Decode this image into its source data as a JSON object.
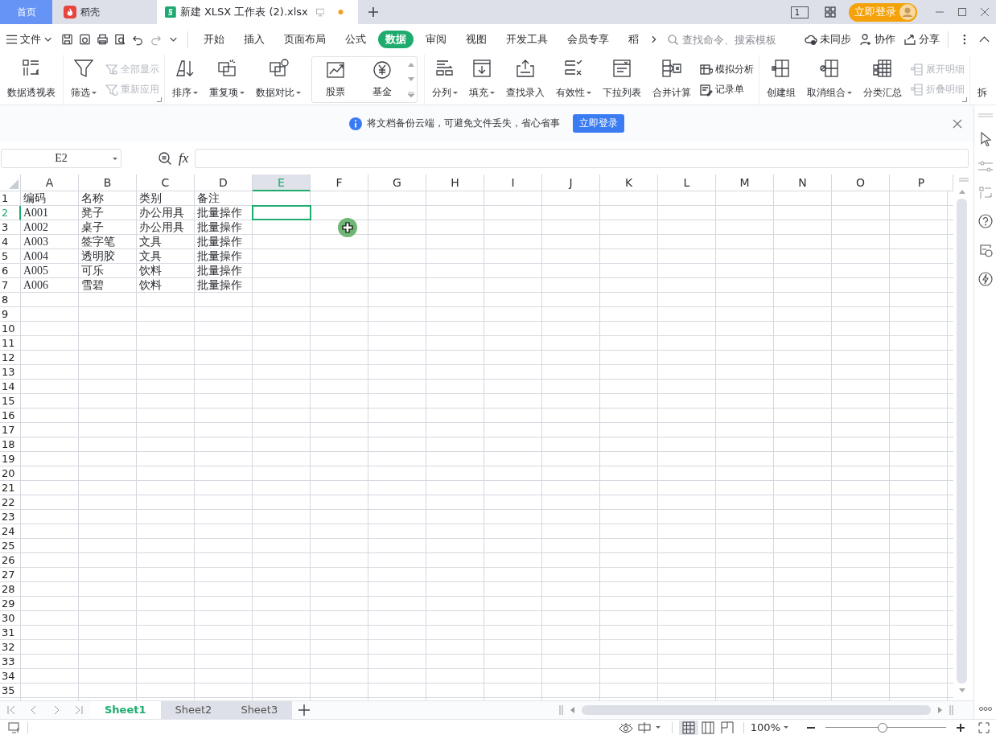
{
  "title_bar": {
    "tabs": [
      {
        "kind": "home",
        "label": "首页",
        "selected": false
      },
      {
        "kind": "docer",
        "label": "稻壳",
        "selected": false
      },
      {
        "kind": "sheet",
        "label": "新建 XLSX 工作表 (2).xlsx",
        "selected": true,
        "unsaved": true
      }
    ],
    "page_count": "1",
    "login_button": "立即登录"
  },
  "menu_bar": {
    "file_menu": "文件",
    "tabs": [
      {
        "label": "开始",
        "selected": false
      },
      {
        "label": "插入",
        "selected": false
      },
      {
        "label": "页面布局",
        "selected": false
      },
      {
        "label": "公式",
        "selected": false
      },
      {
        "label": "数据",
        "selected": true
      },
      {
        "label": "审阅",
        "selected": false
      },
      {
        "label": "视图",
        "selected": false
      },
      {
        "label": "开发工具",
        "selected": false
      },
      {
        "label": "会员专享",
        "selected": false
      },
      {
        "label": "稻",
        "selected": false
      }
    ],
    "search": {
      "placeholder": "查找命令、搜索模板"
    },
    "actions": [
      {
        "label": "未同步"
      },
      {
        "label": "协作"
      },
      {
        "label": "分享"
      }
    ]
  },
  "ribbon": {
    "groups": [
      {
        "launcher": false,
        "items": [
          {
            "kind": "large",
            "label": "数据透视表",
            "dropdown": false
          }
        ]
      },
      {
        "launcher": true,
        "items": [
          {
            "kind": "large",
            "label": "筛选",
            "dropdown": true
          },
          {
            "kind": "stack",
            "items": [
              {
                "label": "全部显示",
                "disabled": true
              },
              {
                "label": "重新应用",
                "disabled": true
              }
            ]
          }
        ]
      },
      {
        "launcher": false,
        "items": [
          {
            "kind": "large",
            "label": "排序",
            "dropdown": true
          },
          {
            "kind": "large",
            "label": "重复项",
            "dropdown": true
          },
          {
            "kind": "large",
            "label": "数据对比",
            "dropdown": true
          },
          {
            "kind": "gallery",
            "items": [
              {
                "label": "股票"
              },
              {
                "label": "基金"
              }
            ]
          }
        ]
      },
      {
        "launcher": false,
        "items": [
          {
            "kind": "large",
            "label": "分列",
            "dropdown": true
          },
          {
            "kind": "large",
            "label": "填充",
            "dropdown": true
          },
          {
            "kind": "large",
            "label": "查找录入",
            "dropdown": false
          },
          {
            "kind": "large",
            "label": "有效性",
            "dropdown": true
          },
          {
            "kind": "large",
            "label": "下拉列表",
            "dropdown": false
          },
          {
            "kind": "large",
            "label": "合并计算",
            "dropdown": false
          },
          {
            "kind": "stack",
            "items": [
              {
                "label": "模拟分析",
                "disabled": false
              },
              {
                "label": "记录单",
                "disabled": false
              }
            ]
          }
        ]
      },
      {
        "launcher": true,
        "items": [
          {
            "kind": "large",
            "label": "创建组",
            "dropdown": false
          },
          {
            "kind": "large",
            "label": "取消组合",
            "dropdown": true
          },
          {
            "kind": "large",
            "label": "分类汇总",
            "dropdown": false
          },
          {
            "kind": "stack",
            "items": [
              {
                "label": "展开明细",
                "disabled": true
              },
              {
                "label": "折叠明细",
                "disabled": true
              }
            ]
          }
        ]
      },
      {
        "launcher": false,
        "items": [
          {
            "kind": "large",
            "label": "拆",
            "dropdown": false
          }
        ]
      }
    ]
  },
  "notice": {
    "text": "将文档备份云端，可避免文件丢失，省心省事",
    "button": "立即登录"
  },
  "formula_bar": {
    "cell_name": "E2",
    "function_label": "fx"
  },
  "grid": {
    "columns": [
      {
        "label": "A",
        "selected": false
      },
      {
        "label": "B",
        "selected": false
      },
      {
        "label": "C",
        "selected": false
      },
      {
        "label": "D",
        "selected": false
      },
      {
        "label": "E",
        "selected": true
      },
      {
        "label": "F",
        "selected": false
      },
      {
        "label": "G",
        "selected": false
      },
      {
        "label": "H",
        "selected": false
      },
      {
        "label": "I",
        "selected": false
      },
      {
        "label": "J",
        "selected": false
      },
      {
        "label": "K",
        "selected": false
      },
      {
        "label": "L",
        "selected": false
      },
      {
        "label": "M",
        "selected": false
      },
      {
        "label": "N",
        "selected": false
      },
      {
        "label": "O",
        "selected": false
      },
      {
        "label": "P",
        "selected": false
      }
    ],
    "rows": [
      {
        "label": "1",
        "selected": false,
        "cells": [
          "编码",
          "名称",
          "类别",
          "备注"
        ]
      },
      {
        "label": "2",
        "selected": true,
        "cells": [
          "A001",
          "凳子",
          "办公用具",
          "批量操作"
        ]
      },
      {
        "label": "3",
        "selected": false,
        "cells": [
          "A002",
          "桌子",
          "办公用具",
          "批量操作"
        ]
      },
      {
        "label": "4",
        "selected": false,
        "cells": [
          "A003",
          "签字笔",
          "文具",
          "批量操作"
        ]
      },
      {
        "label": "5",
        "selected": false,
        "cells": [
          "A004",
          "透明胶",
          "文具",
          "批量操作"
        ]
      },
      {
        "label": "6",
        "selected": false,
        "cells": [
          "A005",
          "可乐",
          "饮料",
          "批量操作"
        ]
      },
      {
        "label": "7",
        "selected": false,
        "cells": [
          "A006",
          "雪碧",
          "饮料",
          "批量操作"
        ]
      },
      {
        "label": "8",
        "selected": false
      },
      {
        "label": "9",
        "selected": false
      },
      {
        "label": "10",
        "selected": false
      },
      {
        "label": "11",
        "selected": false
      },
      {
        "label": "12",
        "selected": false
      },
      {
        "label": "13",
        "selected": false
      },
      {
        "label": "14",
        "selected": false
      },
      {
        "label": "15",
        "selected": false
      },
      {
        "label": "16",
        "selected": false
      },
      {
        "label": "17",
        "selected": false
      },
      {
        "label": "18",
        "selected": false
      },
      {
        "label": "19",
        "selected": false
      },
      {
        "label": "20",
        "selected": false
      },
      {
        "label": "21",
        "selected": false
      },
      {
        "label": "22",
        "selected": false
      },
      {
        "label": "23",
        "selected": false
      },
      {
        "label": "24",
        "selected": false
      },
      {
        "label": "25",
        "selected": false
      },
      {
        "label": "26",
        "selected": false
      },
      {
        "label": "27",
        "selected": false
      },
      {
        "label": "28",
        "selected": false
      },
      {
        "label": "29",
        "selected": false
      },
      {
        "label": "30",
        "selected": false
      },
      {
        "label": "31",
        "selected": false
      },
      {
        "label": "32",
        "selected": false
      },
      {
        "label": "33",
        "selected": false
      },
      {
        "label": "34",
        "selected": false
      },
      {
        "label": "35",
        "selected": false
      }
    ]
  },
  "sheet_tabs": [
    {
      "label": "Sheet1",
      "selected": true
    },
    {
      "label": "Sheet2",
      "selected": false
    },
    {
      "label": "Sheet3",
      "selected": false
    }
  ],
  "status_bar": {
    "views": [
      {
        "selected": true
      },
      {
        "selected": false
      },
      {
        "selected": false
      }
    ],
    "zoom": {
      "reading": "100%",
      "level": 0.47
    }
  }
}
